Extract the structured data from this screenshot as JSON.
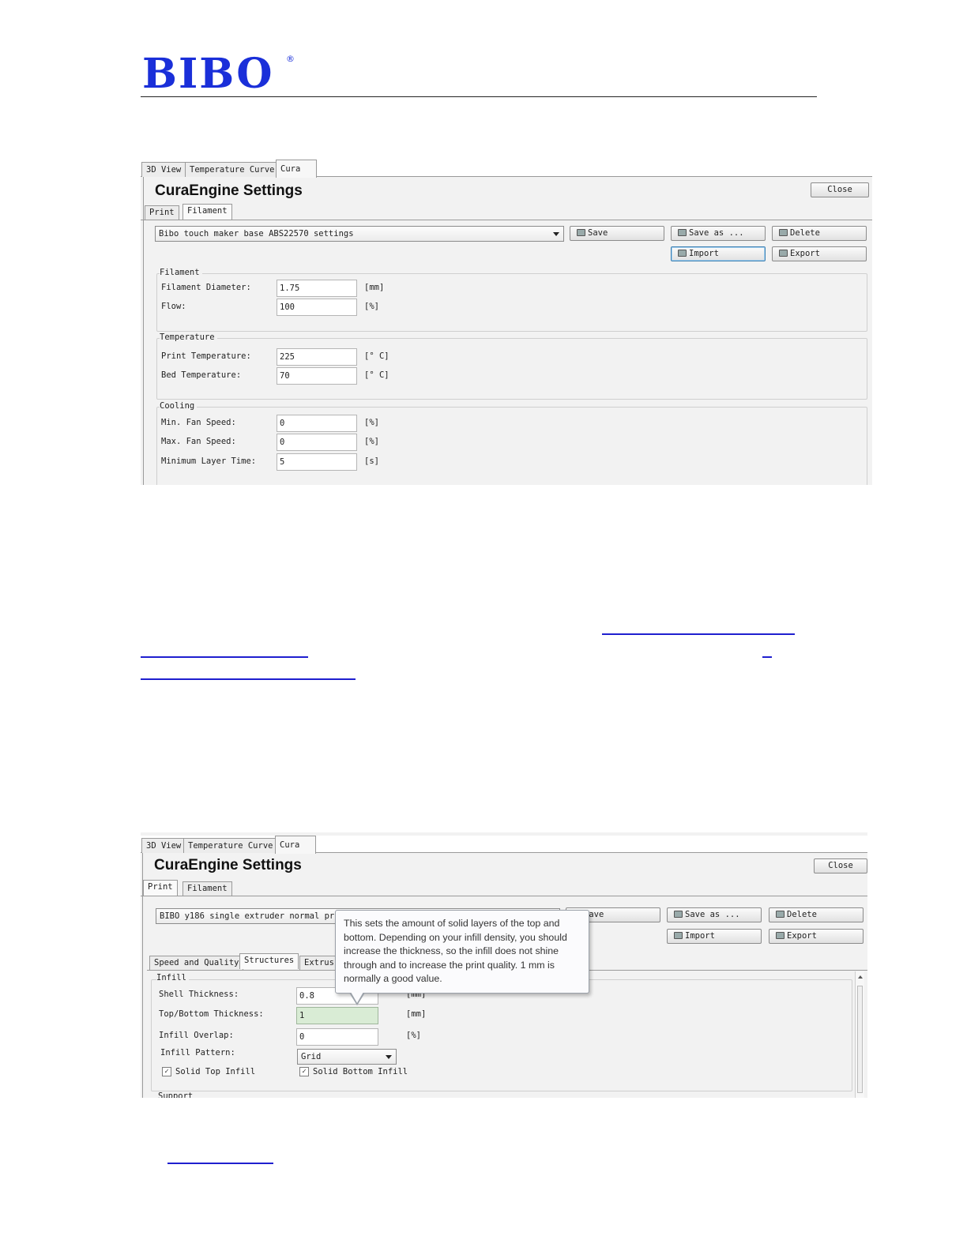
{
  "brand": {
    "logo_text": "BIBO",
    "registered_mark": "®"
  },
  "screenshot_1": {
    "tabs": [
      "3D View",
      "Temperature Curve",
      "Cura"
    ],
    "title": "CuraEngine Settings",
    "close_label": "Close",
    "sub_tabs": [
      "Print",
      "Filament"
    ],
    "profile_value": "Bibo touch maker base ABS22570 settings",
    "buttons": {
      "save": "Save",
      "save_as": "Save as ...",
      "delete": "Delete",
      "import": "Import",
      "export": "Export"
    },
    "filament": {
      "group": "Filament",
      "diameter_label": "Filament Diameter:",
      "diameter_value": "1.75",
      "diameter_unit": "[mm]",
      "flow_label": "Flow:",
      "flow_value": "100",
      "flow_unit": "[%]"
    },
    "temperature": {
      "group": "Temperature",
      "print_label": "Print Temperature:",
      "print_value": "225",
      "print_unit": "[° C]",
      "bed_label": "Bed Temperature:",
      "bed_value": "70",
      "bed_unit": "[° C]"
    },
    "cooling": {
      "group": "Cooling",
      "min_fan_label": "Min. Fan Speed:",
      "min_fan_value": "0",
      "min_fan_unit": "[%]",
      "max_fan_label": "Max. Fan Speed:",
      "max_fan_value": "0",
      "max_fan_unit": "[%]",
      "min_layer_label": "Minimum Layer Time:",
      "min_layer_value": "5",
      "min_layer_unit": "[s]"
    }
  },
  "screenshot_2": {
    "tabs": [
      "3D View",
      "Temperature Curve",
      "Cura"
    ],
    "title": "CuraEngine Settings",
    "close_label": "Close",
    "sub_tabs": [
      "Print",
      "Filament"
    ],
    "profile_value": "BIBO y186 single extruder normal pri",
    "buttons": {
      "save": "Save",
      "save_as": "Save as ...",
      "delete": "Delete",
      "import": "Import",
      "export": "Export"
    },
    "inner_tabs": [
      "Speed and Quality",
      "Structures",
      "Extrus"
    ],
    "infill": {
      "group": "Infill",
      "shell_label": "Shell Thickness:",
      "shell_value": "0.8",
      "shell_unit": "[mm]",
      "topbottom_label": "Top/Bottom Thickness:",
      "topbottom_value": "1",
      "topbottom_unit": "[mm]",
      "overlap_label": "Infill Overlap:",
      "overlap_value": "0",
      "overlap_unit": "[%]",
      "pattern_label": "Infill Pattern:",
      "pattern_value": "Grid",
      "solid_top_label": "Solid Top Infill",
      "solid_bottom_label": "Solid Bottom Infill"
    },
    "support_group": "Support",
    "tooltip": "This sets the amount of solid layers of the top and bottom. Depending on your infill density, you should increase the thickness, so the infill does not shine through and to increase the print quality. 1 mm is normally a good value."
  },
  "colors": {
    "brand_blue": "#1a2fd9",
    "link_blue": "#1f1fcf",
    "highlight_field": "#d9ecd5"
  }
}
